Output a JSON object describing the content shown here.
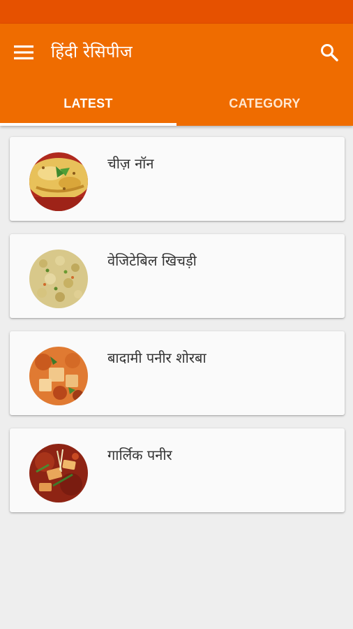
{
  "app": {
    "title": "हिंदी रेसिपीज",
    "colors": {
      "primary": "#ef6c00",
      "primary_dark": "#e65100",
      "background": "#eeeeee",
      "card": "#fafafa"
    },
    "icons": {
      "menu": "menu-icon",
      "search": "search-icon"
    }
  },
  "tabs": [
    {
      "label": "LATEST",
      "selected": true
    },
    {
      "label": "CATEGORY",
      "selected": false
    }
  ],
  "recipes": [
    {
      "title": "चीज़ नॉन",
      "image": "cheese-naan-photo"
    },
    {
      "title": "वेजिटेबिल खिचड़ी",
      "image": "vegetable-khichdi-photo"
    },
    {
      "title": "बादामी पनीर शोरबा",
      "image": "badami-paneer-shorba-photo"
    },
    {
      "title": "गार्लिक पनीर",
      "image": "garlic-paneer-photo"
    }
  ]
}
